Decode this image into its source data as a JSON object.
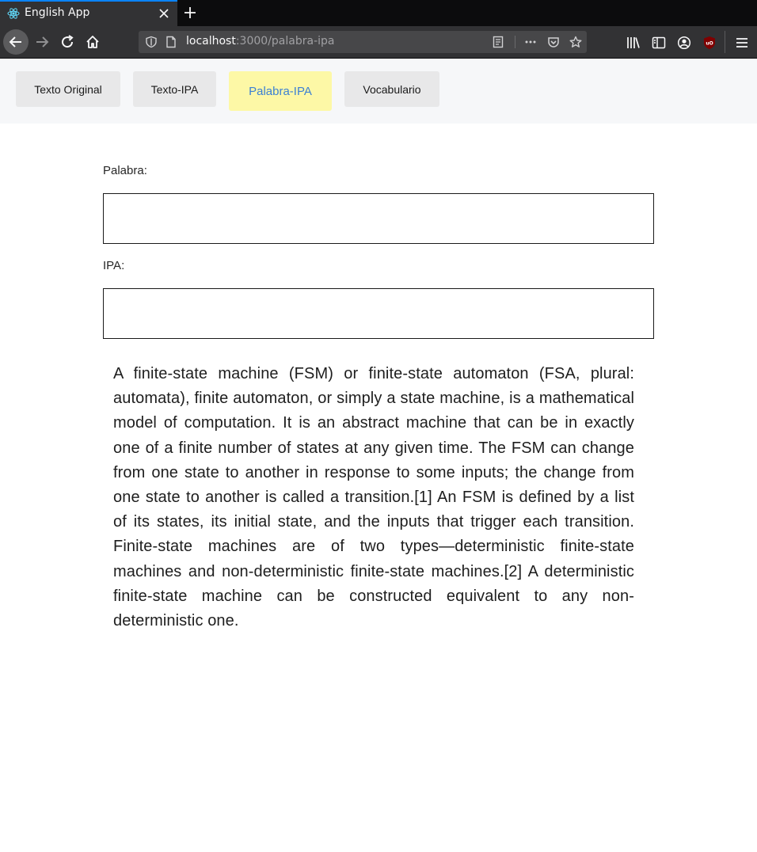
{
  "browser": {
    "tab_title": "English App",
    "url_host": "localhost",
    "url_path": ":3000/palabra-ipa"
  },
  "nav": {
    "links": [
      {
        "label": "Texto Original"
      },
      {
        "label": "Texto-IPA"
      },
      {
        "label": "Palabra-IPA",
        "active": true
      },
      {
        "label": "Vocabulario"
      }
    ]
  },
  "form": {
    "palabra_label": "Palabra:",
    "palabra_value": "",
    "ipa_label": "IPA:",
    "ipa_value": ""
  },
  "content": {
    "paragraph": "A finite-state machine (FSM) or finite-state automaton (FSA, plural: automata), finite automaton, or simply a state machine, is a mathematical model of computation. It is an abstract machine that can be in exactly one of a finite number of states at any given time. The FSM can change from one state to another in response to some inputs; the change from one state to another is called a transition.[1] An FSM is defined by a list of its states, its initial state, and the inputs that trigger each transition. Finite-state machines are of two types—deterministic finite-state machines and non-deterministic finite-state machines.[2] A deterministic finite-state machine can be constructed equivalent to any non-deterministic one."
  },
  "colors": {
    "active_tab_bg": "#fdf8a6",
    "active_tab_text": "#3c80d4",
    "tab_bg": "#e8e8e9",
    "nav_bg": "#f6f7f9"
  },
  "icons": [
    "react-icon",
    "close-icon",
    "plus-icon",
    "back-arrow-icon",
    "forward-arrow-icon",
    "reload-icon",
    "home-icon",
    "shield-icon",
    "page-icon",
    "reader-view-icon",
    "more-icon",
    "pocket-icon",
    "star-icon",
    "library-icon",
    "sidebar-icon",
    "account-icon",
    "ublock-icon",
    "hamburger-menu-icon"
  ]
}
